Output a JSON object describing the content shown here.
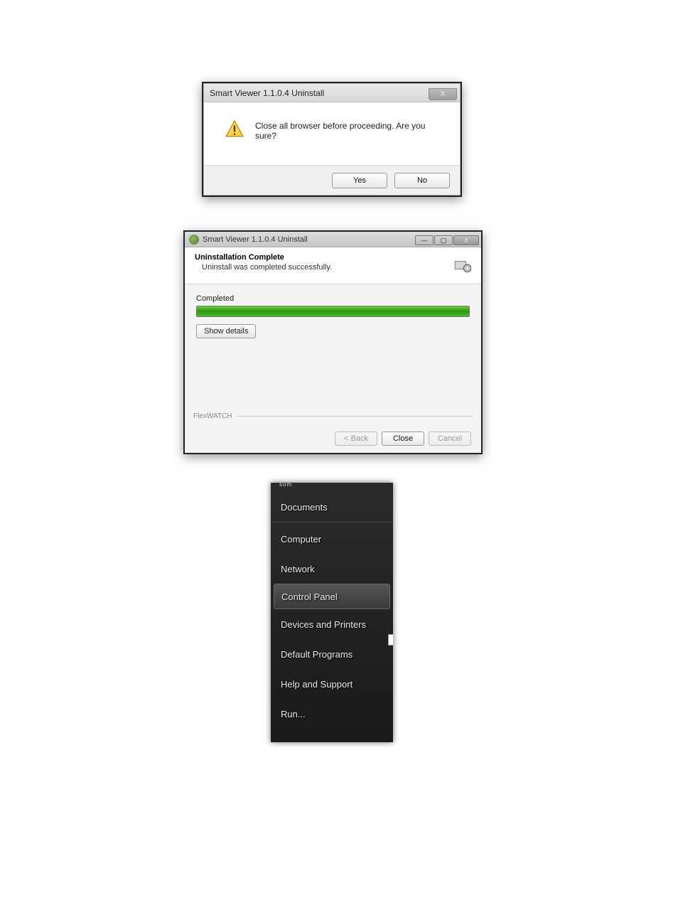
{
  "dialog1": {
    "title": "Smart Viewer 1.1.0.4 Uninstall",
    "closeGlyph": "X",
    "message": "Close all browser before proceeding. Are you sure?",
    "yes": "Yes",
    "no": "No"
  },
  "dialog2": {
    "title": "Smart Viewer 1.1.0.4 Uninstall",
    "minGlyph": "—",
    "maxGlyph": "▢",
    "closeGlyph": "X",
    "heading": "Uninstallation Complete",
    "subheading": "Uninstall was completed successfully.",
    "progressLabel": "Completed",
    "showDetails": "Show details",
    "brand": "FlexWATCH",
    "back": "< Back",
    "close": "Close",
    "cancel": "Cancel"
  },
  "startMenu": {
    "topFragment": "som",
    "items": [
      "Documents",
      "Computer",
      "Network",
      "Control Panel",
      "Devices and Printers",
      "Default Programs",
      "Help and Support",
      "Run..."
    ],
    "selectedIndex": 3
  }
}
